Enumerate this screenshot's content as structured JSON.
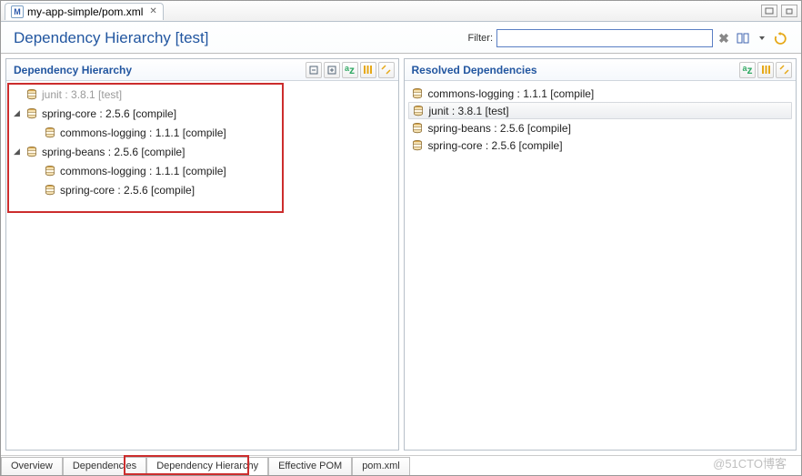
{
  "tab": {
    "label": "my-app-simple/pom.xml"
  },
  "title": "Dependency Hierarchy [test]",
  "filter": {
    "label": "Filter:",
    "value": "",
    "placeholder": ""
  },
  "panels": {
    "left": {
      "title": "Dependency Hierarchy",
      "tree": [
        {
          "label": "junit : 3.8.1 [test]",
          "dim": true,
          "expandable": false,
          "children": []
        },
        {
          "label": "spring-core : 2.5.6 [compile]",
          "dim": false,
          "expandable": true,
          "children": [
            {
              "label": "commons-logging : 1.1.1 [compile]",
              "dim": false
            }
          ]
        },
        {
          "label": "spring-beans : 2.5.6 [compile]",
          "dim": false,
          "expandable": true,
          "children": [
            {
              "label": "commons-logging : 1.1.1 [compile]",
              "dim": false
            },
            {
              "label": "spring-core : 2.5.6 [compile]",
              "dim": false
            }
          ]
        }
      ]
    },
    "right": {
      "title": "Resolved Dependencies",
      "items": [
        {
          "label": "commons-logging : 1.1.1 [compile]",
          "selected": false
        },
        {
          "label": "junit : 3.8.1 [test]",
          "selected": true
        },
        {
          "label": "spring-beans : 2.5.6 [compile]",
          "selected": false
        },
        {
          "label": "spring-core : 2.5.6 [compile]",
          "selected": false
        }
      ]
    }
  },
  "bottomTabs": [
    {
      "label": "Overview",
      "active": false
    },
    {
      "label": "Dependencies",
      "active": false
    },
    {
      "label": "Dependency Hierarchy",
      "active": true
    },
    {
      "label": "Effective POM",
      "active": false
    },
    {
      "label": "pom.xml",
      "active": false
    }
  ],
  "watermark": "@51CTO博客"
}
